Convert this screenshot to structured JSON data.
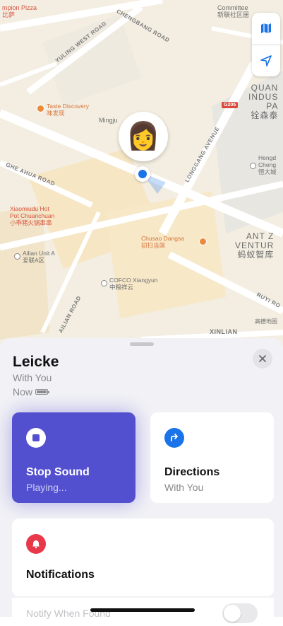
{
  "map": {
    "labels": {
      "pizza": "mpion Pizza\n比萨",
      "committee": "Committee\n新联社区居",
      "yuling": "YULING WEST ROAD",
      "chengbang": "CHENGBANG ROAD",
      "taste": "Taste Discovery\n味发现",
      "mingju": "Mingju",
      "badge": "G205",
      "quan": "QUAN\nINDUS\nPA\n铨森泰",
      "longgang": "LONGGANG AVENUE",
      "hengd": "Hengd\nCheng\n恒大城",
      "ahua": "GHE AHUA ROAD",
      "xiaomiudu": "Xiaomiudu Hot\nPot Chuanchuan\n小乖猪火锅串串",
      "chusao": "Chusao Dangsa\n初扫当飒",
      "antz": "ANT Z\nVENTUR\n蚂蚁智库",
      "ailian": "Ailian Unit A\n爱联A区",
      "cofco": "COFCO Xiangyun\n中粮祥云",
      "ruyi": "RUYI RO",
      "map_data": "高德地图",
      "xinlian": "XINLIAN",
      "ailian_road": "AILIAN ROAD"
    }
  },
  "icons": {
    "map_mode": "map-icon",
    "location": "location-arrow-icon",
    "avatar": "person-emoji",
    "close": "close-icon",
    "stop": "stop-icon",
    "directions": "directions-icon",
    "bell": "bell-icon"
  },
  "avatar_emoji": "👩",
  "device": {
    "name": "Leicke",
    "with": "With You",
    "time": "Now"
  },
  "actions": {
    "stop": {
      "title": "Stop Sound",
      "subtitle": "Playing..."
    },
    "directions": {
      "title": "Directions",
      "subtitle": "With You"
    }
  },
  "notifications": {
    "title": "Notifications",
    "notify_label": "Notify When Found"
  },
  "colors": {
    "stop_card": "#5350d0",
    "directions_icon": "#1a73e8",
    "notifications_icon": "#e8394b"
  }
}
